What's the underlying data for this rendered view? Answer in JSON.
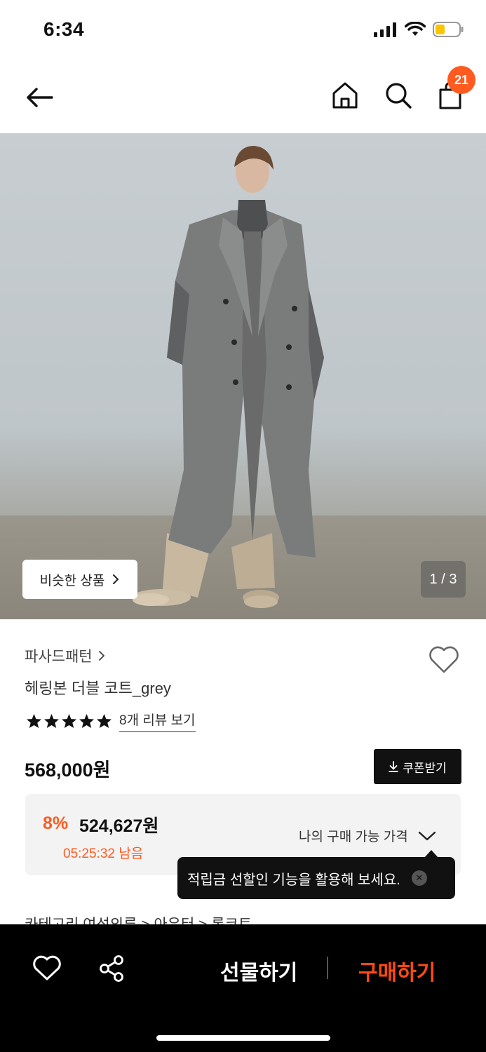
{
  "status_bar": {
    "time": "6:34"
  },
  "nav": {
    "cart_count": "21"
  },
  "hero": {
    "similar_label": "비슷한 상품",
    "page_indicator": "1 / 3"
  },
  "product": {
    "brand": "파사드패턴",
    "title": "헤링본 더블 코트_grey",
    "rating_stars": 5,
    "review_link": "8개 리뷰 보기",
    "price": "568,000원",
    "coupon_label": "쿠폰받기"
  },
  "discount": {
    "rate": "8%",
    "price": "524,627원",
    "countdown": "05:25:32 남음",
    "my_price_label": "나의 구매 가능 가격"
  },
  "tooltip": {
    "text": "적립금 선할인 기능을 활용해 보세요."
  },
  "category": {
    "peek_text": "카테고리        여성의류 > 아우터 > 롱코트"
  },
  "bottom_bar": {
    "gift_label": "선물하기",
    "buy_label": "구매하기"
  },
  "colors": {
    "accent": "#ff5a1f",
    "buy": "#ff4a12"
  }
}
